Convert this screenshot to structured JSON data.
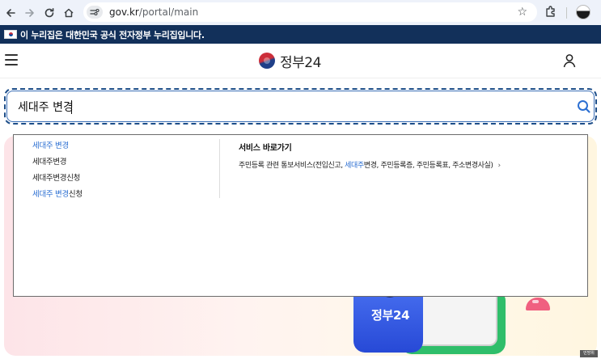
{
  "browser": {
    "url_host": "gov.kr",
    "url_path": "/portal/main",
    "icons": [
      "back-arrow-icon",
      "forward-arrow-icon",
      "reload-icon",
      "home-icon",
      "site-info-icon",
      "star-icon",
      "extensions-icon",
      "profile-avatar"
    ]
  },
  "gov_banner": {
    "text": "이 누리집은 대한민국 공식 전자정부 누리집입니다."
  },
  "header": {
    "logo_text": "정부24",
    "icons": [
      "hamburger-menu-icon",
      "logo-mark-icon",
      "user-icon"
    ]
  },
  "search": {
    "value": "세대주 변경",
    "icon": "search-icon"
  },
  "suggestions": [
    {
      "parts": [
        {
          "text": "세대주 변경",
          "hl": true
        }
      ]
    },
    {
      "parts": [
        {
          "text": "세대주변경",
          "hl": false
        }
      ]
    },
    {
      "parts": [
        {
          "text": "세대주변경신청",
          "hl": false
        }
      ]
    },
    {
      "parts": [
        {
          "text": "세대주 변경",
          "hl": true
        },
        {
          "text": "신청",
          "hl": false
        }
      ]
    }
  ],
  "quick_service": {
    "title": "서비스 바로가기",
    "link_before": "주민등록 관련 통보서비스(전입신고, ",
    "link_highlight": "세대주",
    "link_after": "변경, 주민등록증, 주민등록표, 주소변경사실)",
    "chevron": "›"
  },
  "hero": {
    "logo_text": "정부24"
  },
  "corner_badge": "민방위",
  "colors": {
    "banner": "#12305a",
    "highlight": "#2c6fd2",
    "search_border": "#1d4e89"
  }
}
